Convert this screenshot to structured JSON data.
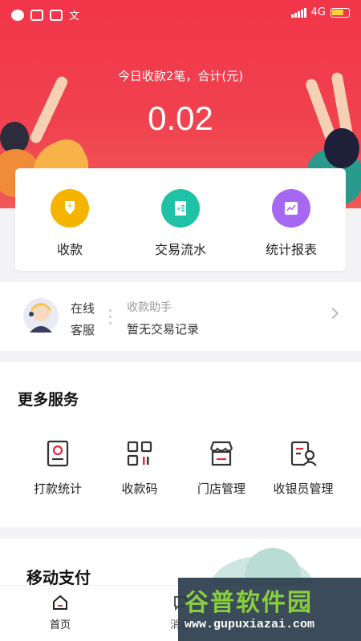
{
  "status_bar": {
    "network": "4G",
    "icons": [
      "app-icon",
      "message-icon",
      "message-icon",
      "translate-icon"
    ]
  },
  "summary": {
    "text": "今日收款2笔，合计(元)",
    "amount": "0.02"
  },
  "quick_actions": [
    {
      "label": "收款",
      "icon": "yuan-receive-icon",
      "color": "#f5b400"
    },
    {
      "label": "交易流水",
      "icon": "receipt-icon",
      "color": "#1fc2a5"
    },
    {
      "label": "统计报表",
      "icon": "report-icon",
      "color": "#a668f0"
    }
  ],
  "assistant": {
    "service_line1": "在线",
    "service_line2": "客服",
    "title": "收款助手",
    "message": "暂无交易记录"
  },
  "services": {
    "title": "更多服务",
    "items": [
      {
        "label": "打款统计",
        "icon": "payment-stats-icon"
      },
      {
        "label": "收款码",
        "icon": "qr-code-icon"
      },
      {
        "label": "门店管理",
        "icon": "store-icon"
      },
      {
        "label": "收银员管理",
        "icon": "cashier-icon"
      }
    ]
  },
  "mobile_pay": {
    "title": "移动支付"
  },
  "tabbar": {
    "home": "首页",
    "messages": "消息"
  },
  "watermark": {
    "brand": "谷普软件园",
    "url": "www.gupuxiazai.com"
  },
  "colors": {
    "hero": "#f2354a",
    "accent": "#e8263f"
  }
}
